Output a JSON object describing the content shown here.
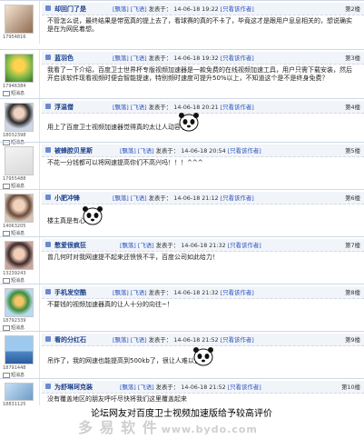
{
  "posts": [
    {
      "name": "却回门了是",
      "uid": "17954816",
      "recv": "短消息",
      "bracket": "[飘落]",
      "flower": "[飞语]",
      "posted": "发表于：",
      "date": "14-06-18 19:22",
      "view_author": "[只看该作者]",
      "floor": "第2楼",
      "content": "不管怎么说，最终结果是带宽真的提上去了，看球赛的真的不卡了，毕竟这才是跟用户息息相关的，想说确实是在为网民着想。"
    },
    {
      "name": "蓝羽色",
      "uid": "17946384",
      "recv": "短消息",
      "bracket": "[飘落]",
      "flower": "[飞语]",
      "posted": "发表于：",
      "date": "14-06-18 19:32",
      "view_author": "[只看该作者]",
      "floor": "第3楼",
      "content": "我看了一下介绍，百度卫士世界杯专版视频加速器是一款免费的在线视频加速工具，用户只需下载安装，然后开启该软件现看视频时便会智能提速，特别频时速度可提升50%以上，不知道这个是不是终身免费？"
    },
    {
      "name": "浮温僧",
      "uid": "18032398",
      "recv": "短消息",
      "bracket": "[飘落]",
      "flower": "[飞语]",
      "posted": "发表于：",
      "date": "14-06-18 20:21",
      "view_author": "[只看该作者]",
      "floor": "第4楼",
      "content": "用上了百度卫士视频加速器觉得真的太让人动容了！"
    },
    {
      "name": "被蜂腔贝里斯",
      "uid": "17955488",
      "recv": "短消息",
      "bracket": "[飘落]",
      "flower": "[飞语]",
      "posted": "发表于：",
      "date": "14-06-18 20:54",
      "view_author": "[只看该作者]",
      "floor": "第5楼",
      "content": "不花一分钱都可以将网速提高你们不高兴吗！！！^^^"
    },
    {
      "name": "小肥冲锋",
      "uid": "14063205",
      "recv": "短消息",
      "bracket": "[飘落]",
      "flower": "[飞语]",
      "posted": "发表于：",
      "date": "14-06-18 21:12",
      "view_author": "[只看该作者]",
      "floor": "第6楼",
      "content": "楼主真是有心啊！"
    },
    {
      "name": "憋爱很疯狂",
      "uid": "13239243",
      "recv": "短消息",
      "bracket": "[飘落]",
      "flower": "[飞语]",
      "posted": "发表于：",
      "date": "14-06-18 21:32",
      "view_author": "[只看该作者]",
      "floor": "第7楼",
      "content": "曾几何时对我网速提不起来还愤愤不平，百度公司如此给力！"
    },
    {
      "name": "手机发空酷",
      "uid": "18792339",
      "recv": "短消息",
      "bracket": "[飘落]",
      "flower": "[飞语]",
      "posted": "发表于：",
      "date": "14-06-18 21:32",
      "view_author": "[只看该作者]",
      "floor": "第8楼",
      "content": "不要钱的视频加速器真的让人十分的向往~！"
    },
    {
      "name": "看的分红石",
      "uid": "18791448",
      "recv": "短消息",
      "bracket": "[飘落]",
      "flower": "[飞语]",
      "posted": "发表于：",
      "date": "14-06-18 21:52",
      "view_author": "[只看该作者]",
      "floor": "第9楼",
      "content": "吊炸了，我的网速也能提高到500kb了，很让人难以置信"
    },
    {
      "name": "为舒琳珂克装",
      "uid": "18831125",
      "recv": "短消息",
      "bracket": "[飘落]",
      "flower": "[飞语]",
      "posted": "发表于：",
      "date": "14-06-18 21:52",
      "view_author": "[只看该作者]",
      "floor": "第10楼",
      "content": "没有覆盖地区的朋友呼吁尽快将我们这里覆盖起来"
    }
  ],
  "footer_caption": "论坛网友对百度卫士视频加速版给予较高评价",
  "watermark": {
    "text": "多 易 软 件",
    "url": "www.bydo.com"
  },
  "colors": {
    "name": "#1b3f8b",
    "link": "#2a52be",
    "header_bg": "#f1f4f9",
    "border": "#cfd8e6"
  }
}
